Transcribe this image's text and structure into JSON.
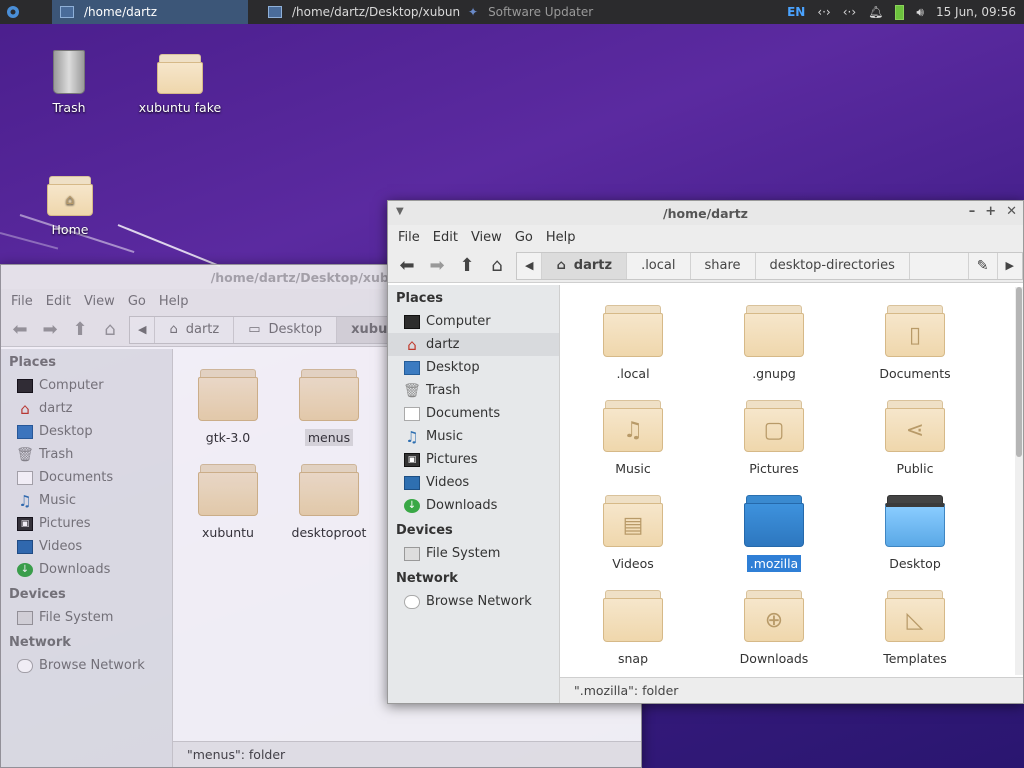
{
  "panel": {
    "tasks": [
      {
        "label": "/home/dartz",
        "active": true
      },
      {
        "label": "/home/dartz/Desktop/xubun...",
        "active": false
      },
      {
        "label": "Software Updater",
        "active": false
      }
    ],
    "lang": "EN",
    "clock": "15 Jun, 09:56"
  },
  "desktop": {
    "icons": [
      {
        "label": "Trash"
      },
      {
        "label": "xubuntu fake"
      },
      {
        "label": "Home"
      }
    ]
  },
  "back_window": {
    "title": "/home/dartz/Desktop/xubuntu f",
    "menus": [
      "File",
      "Edit",
      "View",
      "Go",
      "Help"
    ],
    "crumbs": [
      "dartz",
      "Desktop",
      "xubuntu f"
    ],
    "places_header": "Places",
    "places": [
      "Computer",
      "dartz",
      "Desktop",
      "Trash",
      "Documents",
      "Music",
      "Pictures",
      "Videos",
      "Downloads"
    ],
    "devices_header": "Devices",
    "devices": [
      "File System"
    ],
    "network_header": "Network",
    "network": [
      "Browse Network"
    ],
    "items": [
      "gtk-3.0",
      "menus",
      "xubuntu",
      "desktoproot"
    ],
    "status": "\"menus\": folder"
  },
  "front_window": {
    "title": "/home/dartz",
    "menus": [
      "File",
      "Edit",
      "View",
      "Go",
      "Help"
    ],
    "crumbs": [
      "dartz",
      ".local",
      "share",
      "desktop-directories"
    ],
    "places_header": "Places",
    "places": [
      "Computer",
      "dartz",
      "Desktop",
      "Trash",
      "Documents",
      "Music",
      "Pictures",
      "Videos",
      "Downloads"
    ],
    "devices_header": "Devices",
    "devices": [
      "File System"
    ],
    "network_header": "Network",
    "network": [
      "Browse Network"
    ],
    "items": [
      ".local",
      ".gnupg",
      "Documents",
      "Music",
      "Pictures",
      "Public",
      "Videos",
      ".mozilla",
      "Desktop",
      "snap",
      "Downloads",
      "Templates"
    ],
    "status": "\".mozilla\": folder"
  },
  "colors": {
    "selection": "#2f7fd6",
    "panel": "#2b2b2d",
    "desktop": "#4a1e8c"
  }
}
